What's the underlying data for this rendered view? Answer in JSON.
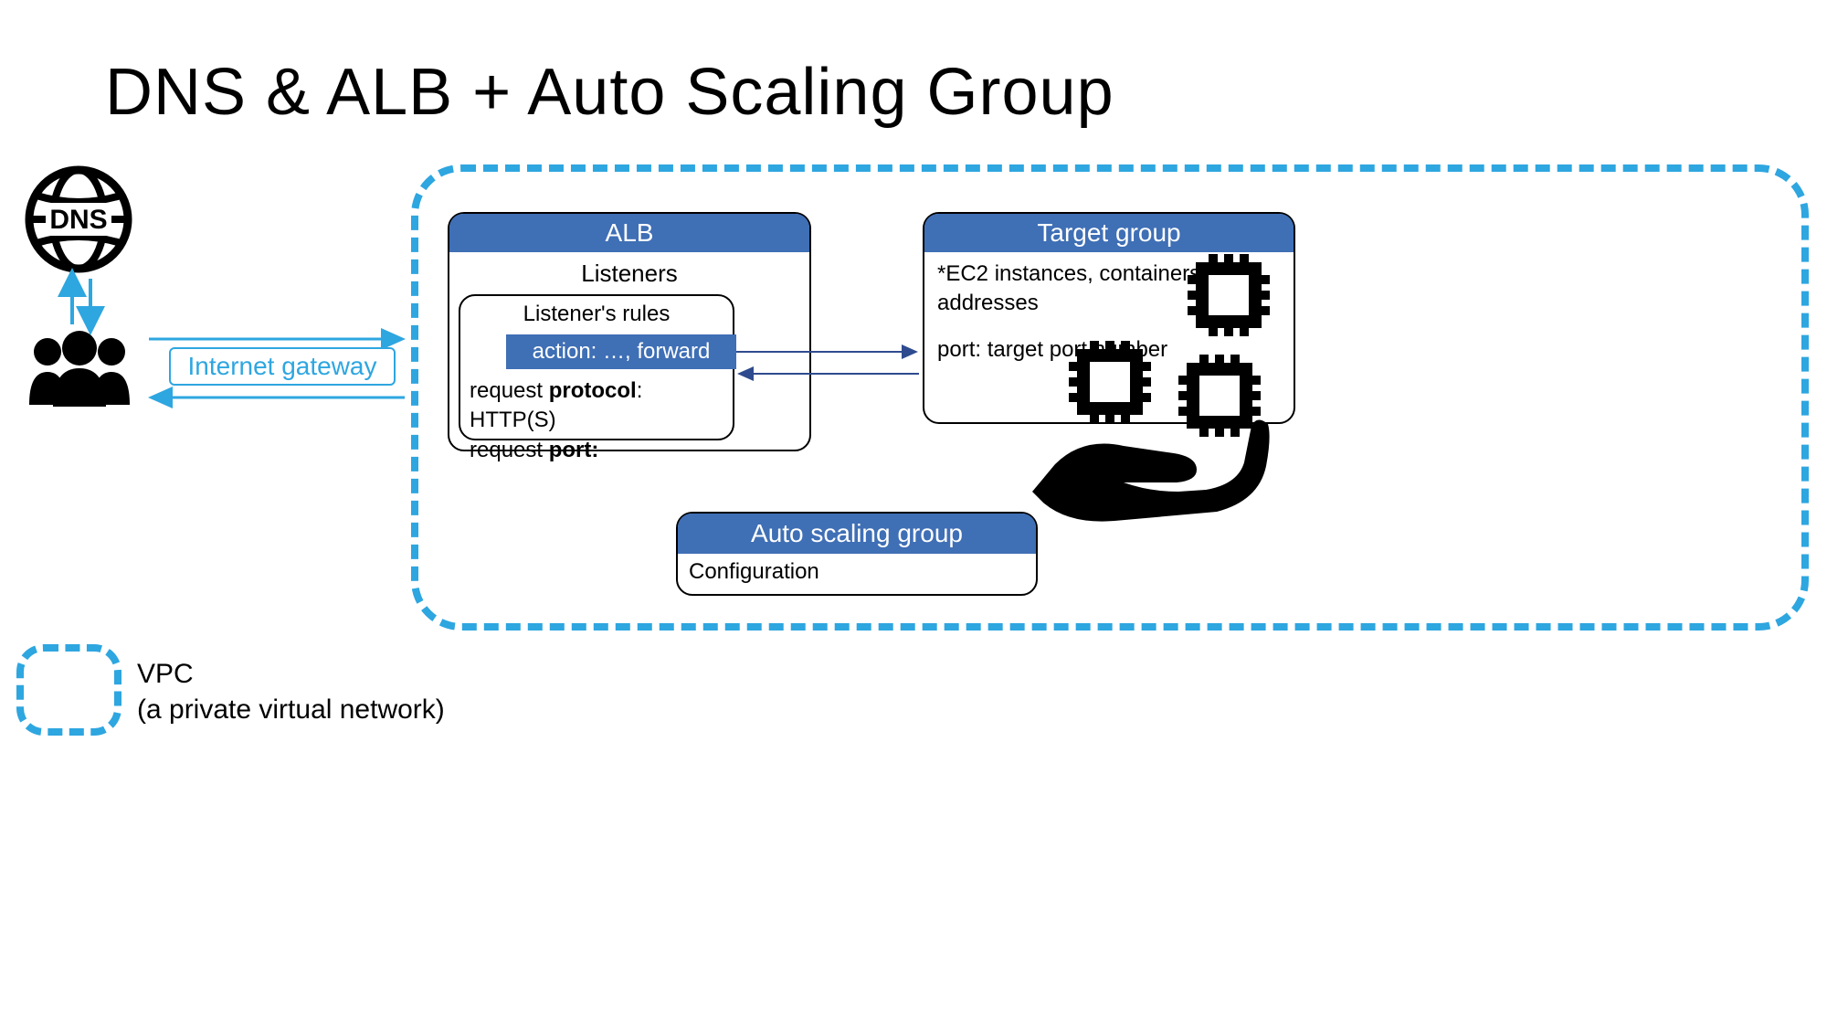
{
  "title": "DNS & ALB + Auto Scaling Group",
  "internet_gateway": "Internet gateway",
  "alb": {
    "header": "ALB",
    "sub": "Listeners",
    "rules_title": "Listener's rules",
    "action": "action: …, forward",
    "protocol_label": "request ",
    "protocol_bold": "protocol",
    "protocol_val": ": HTTP(S)",
    "port_label": "request ",
    "port_bold": "port:"
  },
  "tg": {
    "header": "Target group",
    "line1": "*EC2 instances, containers, IP addresses",
    "line2": "port: target port number"
  },
  "asg": {
    "header": "Auto scaling group",
    "body": "Configuration"
  },
  "legend": {
    "line1": "VPC",
    "line2": "(a private virtual network)"
  },
  "icons": {
    "dns": "dns-globe-icon",
    "users": "users-icon",
    "hand": "hand-serving-chips-icon"
  },
  "colors": {
    "accent_blue": "#2ea6e0",
    "header_blue": "#3f6fb5",
    "arrow_dark": "#2f4b8f"
  }
}
